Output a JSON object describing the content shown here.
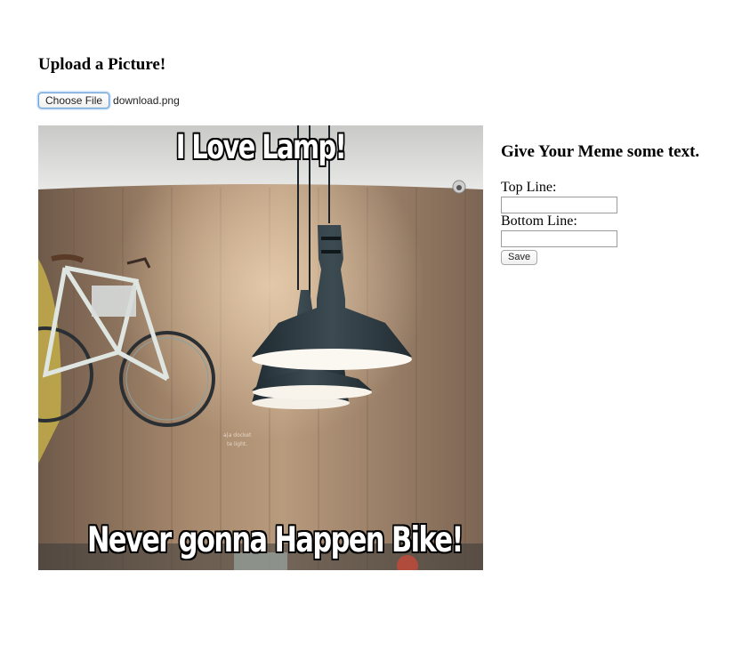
{
  "upload": {
    "heading": "Upload a Picture!",
    "choose_file_label": "Choose File",
    "file_name": "download.png"
  },
  "meme": {
    "top_text": "I Love Lamp!",
    "bottom_text": "Never gonna Happen Bike!"
  },
  "form": {
    "heading": "Give Your Meme some text.",
    "top_line_label": "Top Line:",
    "top_line_value": "",
    "bottom_line_label": "Bottom Line:",
    "bottom_line_value": "",
    "save_label": "Save"
  }
}
